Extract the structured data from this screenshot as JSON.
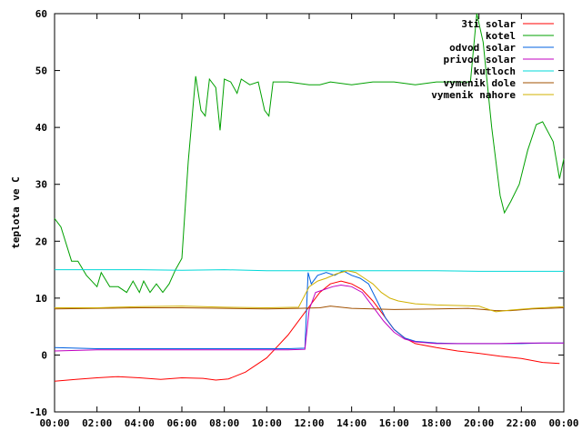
{
  "chart_data": {
    "type": "line",
    "title": "",
    "xlabel": "",
    "ylabel": "teplota ve C",
    "xlim": [
      0,
      24
    ],
    "ylim": [
      -10,
      60
    ],
    "x_ticks": [
      "00:00",
      "02:00",
      "04:00",
      "06:00",
      "08:00",
      "10:00",
      "12:00",
      "14:00",
      "16:00",
      "18:00",
      "20:00",
      "22:00",
      "00:00"
    ],
    "y_ticks": [
      "-10",
      "0",
      "10",
      "20",
      "30",
      "40",
      "50",
      "60"
    ],
    "grid": false,
    "legend_position": "top-right",
    "series": [
      {
        "name": "3ti solar",
        "color": "#ff0000",
        "points": [
          [
            0,
            -4.6
          ],
          [
            1,
            -4.3
          ],
          [
            2,
            -4.0
          ],
          [
            3,
            -3.8
          ],
          [
            4,
            -4.0
          ],
          [
            5,
            -4.3
          ],
          [
            6,
            -4.0
          ],
          [
            7,
            -4.1
          ],
          [
            7.6,
            -4.4
          ],
          [
            8.2,
            -4.2
          ],
          [
            9,
            -3.0
          ],
          [
            10,
            -0.5
          ],
          [
            11,
            3.5
          ],
          [
            12,
            8.5
          ],
          [
            12.5,
            11.0
          ],
          [
            13,
            12.5
          ],
          [
            13.5,
            13.0
          ],
          [
            14,
            12.5
          ],
          [
            14.5,
            11.5
          ],
          [
            15,
            9.5
          ],
          [
            15.5,
            7.0
          ],
          [
            16,
            4.5
          ],
          [
            16.5,
            3.0
          ],
          [
            17,
            2.0
          ],
          [
            18,
            1.3
          ],
          [
            19,
            0.7
          ],
          [
            20,
            0.3
          ],
          [
            21,
            -0.2
          ],
          [
            22,
            -0.6
          ],
          [
            23,
            -1.3
          ],
          [
            23.8,
            -1.5
          ]
        ]
      },
      {
        "name": "kotel",
        "color": "#00a000",
        "points": [
          [
            0,
            24
          ],
          [
            0.3,
            22.5
          ],
          [
            0.8,
            16.5
          ],
          [
            1.1,
            16.5
          ],
          [
            1.5,
            14
          ],
          [
            2.0,
            12
          ],
          [
            2.2,
            14.5
          ],
          [
            2.6,
            12
          ],
          [
            3.0,
            12
          ],
          [
            3.4,
            11
          ],
          [
            3.7,
            13
          ],
          [
            4.0,
            11
          ],
          [
            4.2,
            13
          ],
          [
            4.5,
            11
          ],
          [
            4.8,
            12.5
          ],
          [
            5.1,
            11
          ],
          [
            5.4,
            12.5
          ],
          [
            5.7,
            15
          ],
          [
            6.0,
            17
          ],
          [
            6.3,
            34
          ],
          [
            6.65,
            49
          ],
          [
            6.9,
            43
          ],
          [
            7.1,
            42
          ],
          [
            7.3,
            48.5
          ],
          [
            7.6,
            47
          ],
          [
            7.8,
            39.5
          ],
          [
            8.0,
            48.5
          ],
          [
            8.3,
            48
          ],
          [
            8.6,
            46
          ],
          [
            8.8,
            48.5
          ],
          [
            9.2,
            47.5
          ],
          [
            9.6,
            48
          ],
          [
            9.9,
            43
          ],
          [
            10.1,
            42
          ],
          [
            10.3,
            48
          ],
          [
            11,
            48
          ],
          [
            12,
            47.5
          ],
          [
            12.5,
            47.5
          ],
          [
            13,
            48
          ],
          [
            14,
            47.5
          ],
          [
            15,
            48
          ],
          [
            16,
            48
          ],
          [
            17,
            47.5
          ],
          [
            18,
            48
          ],
          [
            19,
            48
          ],
          [
            19.6,
            48
          ],
          [
            19.9,
            60
          ],
          [
            20.2,
            55
          ],
          [
            20.6,
            40
          ],
          [
            21.0,
            28
          ],
          [
            21.2,
            25
          ],
          [
            21.5,
            27
          ],
          [
            21.9,
            30
          ],
          [
            22.3,
            36
          ],
          [
            22.7,
            40.5
          ],
          [
            23.0,
            41
          ],
          [
            23.5,
            37.5
          ],
          [
            23.8,
            31
          ],
          [
            24.0,
            34.5
          ]
        ]
      },
      {
        "name": "odvod solar",
        "color": "#0060e0",
        "points": [
          [
            0,
            1.3
          ],
          [
            1,
            1.2
          ],
          [
            2,
            1.1
          ],
          [
            3,
            1.1
          ],
          [
            4,
            1.1
          ],
          [
            5,
            1.1
          ],
          [
            6,
            1.1
          ],
          [
            7,
            1.1
          ],
          [
            8,
            1.1
          ],
          [
            9,
            1.1
          ],
          [
            10,
            1.1
          ],
          [
            11,
            1.1
          ],
          [
            11.8,
            1.2
          ],
          [
            11.95,
            14.5
          ],
          [
            12.1,
            12.5
          ],
          [
            12.4,
            14.0
          ],
          [
            12.8,
            14.5
          ],
          [
            13.2,
            14.0
          ],
          [
            13.6,
            14.8
          ],
          [
            14.0,
            14.0
          ],
          [
            14.4,
            13.5
          ],
          [
            14.8,
            12.5
          ],
          [
            15.2,
            9.5
          ],
          [
            15.6,
            6.5
          ],
          [
            16.0,
            4.5
          ],
          [
            16.5,
            3.0
          ],
          [
            17,
            2.4
          ],
          [
            18,
            2.1
          ],
          [
            19,
            2.0
          ],
          [
            20,
            2.0
          ],
          [
            21,
            2.0
          ],
          [
            22,
            2.0
          ],
          [
            23,
            2.1
          ],
          [
            24,
            2.1
          ]
        ]
      },
      {
        "name": "privod solar",
        "color": "#c000c0",
        "points": [
          [
            0,
            0.7
          ],
          [
            1,
            0.8
          ],
          [
            2,
            0.9
          ],
          [
            3,
            0.9
          ],
          [
            4,
            0.9
          ],
          [
            5,
            0.9
          ],
          [
            6,
            0.9
          ],
          [
            7,
            0.9
          ],
          [
            8,
            0.9
          ],
          [
            9,
            0.9
          ],
          [
            10,
            0.9
          ],
          [
            11,
            0.9
          ],
          [
            11.8,
            1.0
          ],
          [
            12.0,
            8.0
          ],
          [
            12.3,
            11.0
          ],
          [
            12.7,
            11.5
          ],
          [
            13.1,
            12.0
          ],
          [
            13.5,
            12.3
          ],
          [
            14.0,
            12.0
          ],
          [
            14.5,
            11.0
          ],
          [
            15.0,
            8.5
          ],
          [
            15.5,
            6.0
          ],
          [
            16.0,
            4.0
          ],
          [
            16.5,
            2.8
          ],
          [
            17,
            2.3
          ],
          [
            18,
            2.0
          ],
          [
            19,
            2.0
          ],
          [
            20,
            2.0
          ],
          [
            21,
            2.0
          ],
          [
            22,
            2.1
          ],
          [
            23,
            2.1
          ],
          [
            24,
            2.1
          ]
        ]
      },
      {
        "name": "kutloch",
        "color": "#00d8d8",
        "points": [
          [
            0,
            15.0
          ],
          [
            2,
            15.0
          ],
          [
            4,
            15.0
          ],
          [
            6,
            14.9
          ],
          [
            8,
            15.0
          ],
          [
            10,
            14.8
          ],
          [
            12,
            14.8
          ],
          [
            14,
            14.8
          ],
          [
            16,
            14.8
          ],
          [
            18,
            14.8
          ],
          [
            20,
            14.7
          ],
          [
            22,
            14.7
          ],
          [
            24,
            14.7
          ]
        ]
      },
      {
        "name": "vymenik dole",
        "color": "#a05000",
        "points": [
          [
            0,
            8.1
          ],
          [
            2,
            8.2
          ],
          [
            4,
            8.3
          ],
          [
            6,
            8.3
          ],
          [
            8,
            8.2
          ],
          [
            10,
            8.1
          ],
          [
            11.5,
            8.2
          ],
          [
            12.5,
            8.3
          ],
          [
            13.0,
            8.6
          ],
          [
            14,
            8.2
          ],
          [
            16,
            8.0
          ],
          [
            18,
            8.1
          ],
          [
            19.5,
            8.2
          ],
          [
            20.2,
            8.0
          ],
          [
            20.8,
            7.8
          ],
          [
            21.5,
            7.8
          ],
          [
            22.5,
            8.1
          ],
          [
            24,
            8.3
          ]
        ]
      },
      {
        "name": "vymenik nahore",
        "color": "#d0b000",
        "points": [
          [
            0,
            8.3
          ],
          [
            2,
            8.3
          ],
          [
            4,
            8.5
          ],
          [
            6,
            8.6
          ],
          [
            8,
            8.4
          ],
          [
            10,
            8.3
          ],
          [
            11.5,
            8.4
          ],
          [
            12,
            12.0
          ],
          [
            12.4,
            13.0
          ],
          [
            12.8,
            13.5
          ],
          [
            13.3,
            14.3
          ],
          [
            13.8,
            14.8
          ],
          [
            14.2,
            14.5
          ],
          [
            14.6,
            13.5
          ],
          [
            15.0,
            12.5
          ],
          [
            15.4,
            11.0
          ],
          [
            15.8,
            10.0
          ],
          [
            16.2,
            9.5
          ],
          [
            17,
            9.0
          ],
          [
            18,
            8.8
          ],
          [
            19,
            8.7
          ],
          [
            20,
            8.6
          ],
          [
            20.3,
            8.2
          ],
          [
            20.8,
            7.6
          ],
          [
            21.5,
            7.9
          ],
          [
            22.5,
            8.2
          ],
          [
            24,
            8.5
          ]
        ]
      }
    ]
  }
}
